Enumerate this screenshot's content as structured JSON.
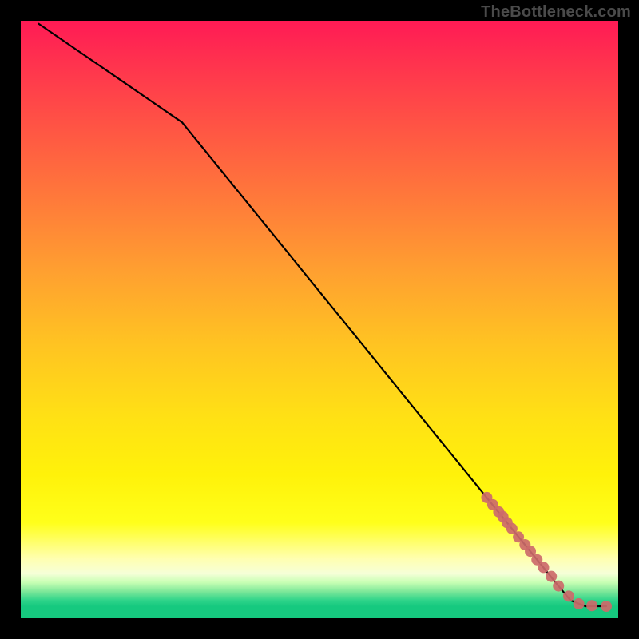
{
  "watermark": "TheBottleneck.com",
  "chart_data": {
    "type": "line",
    "title": "",
    "xlabel": "",
    "ylabel": "",
    "xlim": [
      0,
      100
    ],
    "ylim": [
      0,
      100
    ],
    "grid": false,
    "legend": false,
    "notes": "Axes are unlabeled; coordinates are read in percent of plot width (x, left→right) and plot height (y, bottom→top). The black curve is piecewise-linear through the listed points. Scatter dots lie on the lower-right segment of the curve.",
    "series": [
      {
        "name": "curve",
        "kind": "line",
        "color": "#000000",
        "x": [
          3.0,
          27.0,
          89.5,
          92.0,
          94.5,
          98.0
        ],
        "y": [
          99.5,
          83.0,
          6.0,
          3.0,
          2.0,
          2.0
        ]
      },
      {
        "name": "dots",
        "kind": "scatter",
        "color": "#cc6a6a",
        "radius_px": 7,
        "x": [
          78.0,
          79.0,
          80.0,
          80.7,
          81.4,
          82.2,
          83.3,
          84.4,
          85.3,
          86.4,
          87.5,
          88.8,
          90.0,
          91.7,
          93.4,
          95.6,
          98.0
        ],
        "y": [
          20.2,
          19.0,
          17.8,
          17.0,
          16.0,
          15.0,
          13.6,
          12.3,
          11.2,
          9.8,
          8.5,
          7.0,
          5.4,
          3.7,
          2.4,
          2.1,
          2.0
        ]
      }
    ]
  }
}
